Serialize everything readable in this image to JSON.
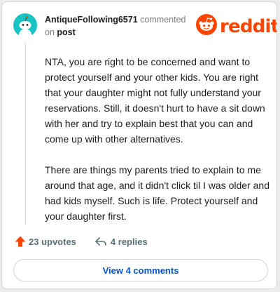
{
  "comment": {
    "username": "AntiqueFollowing6571",
    "action_text": "commented",
    "on_text": "on",
    "post_link": "post",
    "paragraphs": [
      "NTA, you are right to be concerned and want to protect yourself and your other kids. You are right that your daughter might not fully understand your reservations. Still, it doesn't hurt to have a sit down with her and try to explain best that you can and come up with other alternatives.",
      "There are things my parents tried to explain to me around that age, and it didn't click til I was older and had kids myself. Such is life. Protect yourself and your daughter first."
    ],
    "upvotes_label": "23 upvotes",
    "replies_label": "4 replies",
    "view_comments_label": "View 4 comments"
  },
  "brand": {
    "name": "reddit",
    "color": "#ff4500"
  },
  "icons": {
    "avatar": "snoo-avatar-icon",
    "brand": "reddit-snoo-logo-icon",
    "upvote": "upvote-arrow-icon",
    "reply": "reply-arrow-icon"
  },
  "colors": {
    "upvote": "#ff4500",
    "link": "#0a55cc",
    "muted": "#7c7c7c"
  }
}
